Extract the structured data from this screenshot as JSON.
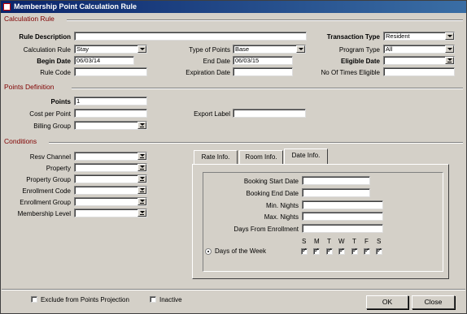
{
  "window": {
    "title": "Membership Point Calculation Rule"
  },
  "sections": {
    "calculation_rule": "Calculation Rule",
    "points_definition": "Points Definition",
    "conditions": "Conditions"
  },
  "calc": {
    "rule_description_label": "Rule Description",
    "rule_description_value": "",
    "calculation_rule_label": "Calculation Rule",
    "calculation_rule_value": "Stay",
    "begin_date_label": "Begin Date",
    "begin_date_value": "06/03/14",
    "rule_code_label": "Rule Code",
    "rule_code_value": "",
    "type_of_points_label": "Type of Points",
    "type_of_points_value": "Base",
    "end_date_label": "End Date",
    "end_date_value": "06/03/15",
    "expiration_date_label": "Expiration Date",
    "expiration_date_value": "",
    "transaction_type_label": "Transaction Type",
    "transaction_type_value": "Resident",
    "program_type_label": "Program Type",
    "program_type_value": "All",
    "eligible_date_label": "Eligible Date",
    "eligible_date_value": "",
    "no_of_times_label": "No Of Times Eligible",
    "no_of_times_value": ""
  },
  "points": {
    "points_label": "Points",
    "points_value": "1",
    "cost_per_point_label": "Cost per Point",
    "cost_per_point_value": "",
    "billing_group_label": "Billing Group",
    "billing_group_value": "",
    "export_label_label": "Export Label",
    "export_label_value": ""
  },
  "conditions": {
    "resv_channel": "Resv Channel",
    "property": "Property",
    "property_group": "Property Group",
    "enrollment_code": "Enrollment Code",
    "enrollment_group": "Enrollment Group",
    "membership_level": "Membership Level"
  },
  "tabs": [
    "Rate Info.",
    "Room Info.",
    "Date Info."
  ],
  "date_info": {
    "booking_start": "Booking Start Date",
    "booking_end": "Booking End Date",
    "min_nights": "Min. Nights",
    "max_nights": "Max. Nights",
    "days_from_enrollment": "Days From Enrollment",
    "days_of_week_label": "Days of the Week",
    "days": [
      "S",
      "M",
      "T",
      "W",
      "T",
      "F",
      "S"
    ]
  },
  "footer": {
    "exclude_label": "Exclude from Points Projection",
    "inactive_label": "Inactive",
    "ok_label": "OK",
    "close_label": "Close"
  }
}
